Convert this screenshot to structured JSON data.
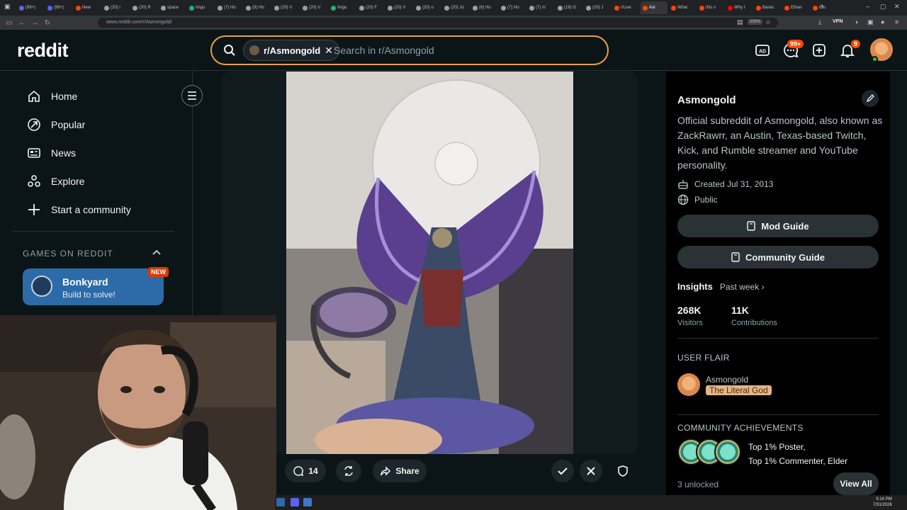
{
  "browser": {
    "tabs": [
      {
        "label": "(99+)",
        "color": "#5865f2"
      },
      {
        "label": "(99+)",
        "color": "#5865f2"
      },
      {
        "label": "New",
        "color": "#ff4500"
      },
      {
        "label": "(20) l",
        "color": "#9aa0a6"
      },
      {
        "label": "(20) R",
        "color": "#9aa0a6"
      },
      {
        "label": "space",
        "color": "#9aa0a6"
      },
      {
        "label": "Imgu",
        "color": "#1bb76e"
      },
      {
        "label": "(7) Ho",
        "color": "#9aa0a6"
      },
      {
        "label": "(9) Ho",
        "color": "#9aa0a6"
      },
      {
        "label": "(20) V",
        "color": "#9aa0a6"
      },
      {
        "label": "(20) V",
        "color": "#9aa0a6"
      },
      {
        "label": "Imgu",
        "color": "#1bb76e"
      },
      {
        "label": "(20) F",
        "color": "#9aa0a6"
      },
      {
        "label": "(20) V",
        "color": "#9aa0a6"
      },
      {
        "label": "(20) o",
        "color": "#9aa0a6"
      },
      {
        "label": "(20) Jo",
        "color": "#9aa0a6"
      },
      {
        "label": "(6) Ho",
        "color": "#9aa0a6"
      },
      {
        "label": "(7) Ho",
        "color": "#9aa0a6"
      },
      {
        "label": "(7) n/",
        "color": "#9aa0a6"
      },
      {
        "label": "(19) G",
        "color": "#9aa0a6"
      },
      {
        "label": "(20) J",
        "color": "#9aa0a6"
      },
      {
        "label": "r/Live",
        "color": "#ff4500"
      },
      {
        "label": "Asr",
        "color": "#ff4500",
        "active": true
      },
      {
        "label": "What",
        "color": "#ff4500"
      },
      {
        "label": "this v",
        "color": "#ff4500"
      },
      {
        "label": "Why I",
        "color": "#ff0000"
      },
      {
        "label": "Basec",
        "color": "#ff4500"
      },
      {
        "label": "Ethan",
        "color": "#ff4500"
      },
      {
        "label": "iDu",
        "color": "#ff4500"
      }
    ],
    "url": "www.reddit.com/r/Asmongold/",
    "zoom": "200%",
    "vpn": "VPN"
  },
  "header": {
    "logo": "reddit",
    "search_chip": "r/Asmongold",
    "search_placeholder": "Search in r/Asmongold",
    "chat_badge": "99+",
    "notif_badge": "9"
  },
  "sidebar": {
    "items": [
      {
        "label": "Home",
        "icon": "home-icon"
      },
      {
        "label": "Popular",
        "icon": "popular-icon"
      },
      {
        "label": "News",
        "icon": "news-icon"
      },
      {
        "label": "Explore",
        "icon": "explore-icon"
      },
      {
        "label": "Start a community",
        "icon": "plus-icon"
      }
    ],
    "games_heading": "GAMES ON REDDIT",
    "game": {
      "title": "Bonkyard",
      "subtitle": "Build to solve!",
      "badge": "NEW"
    }
  },
  "post": {
    "comments": "14",
    "share_label": "Share"
  },
  "community": {
    "name": "Asmongold",
    "description": "Official subreddit of Asmongold, also known as ZackRawrr, an Austin, Texas-based Twitch, Kick, and Rumble streamer and YouTube personality.",
    "created": "Created Jul 31, 2013",
    "visibility": "Public",
    "mod_guide": "Mod Guide",
    "community_guide": "Community Guide",
    "insights_label": "Insights",
    "insights_period": "Past week",
    "visitors_value": "268K",
    "visitors_label": "Visitors",
    "contrib_value": "11K",
    "contrib_label": "Contributions",
    "user_flair_heading": "USER FLAIR",
    "flair_user": "Asmongold",
    "flair_tag": "The Literal God",
    "achievements_heading": "COMMUNITY ACHIEVEMENTS",
    "achievement_line1": "Top 1% Poster,",
    "achievement_line2": "Top 1% Commenter, Elder",
    "unlocked": "3 unlocked",
    "view_all": "View All"
  },
  "taskbar": {
    "time": "5:14 PM",
    "date": "7/31/2026"
  },
  "colors": {
    "accent_orange": "#ff4500",
    "search_border": "#e8a33d",
    "game_card": "#2d6aa8"
  }
}
